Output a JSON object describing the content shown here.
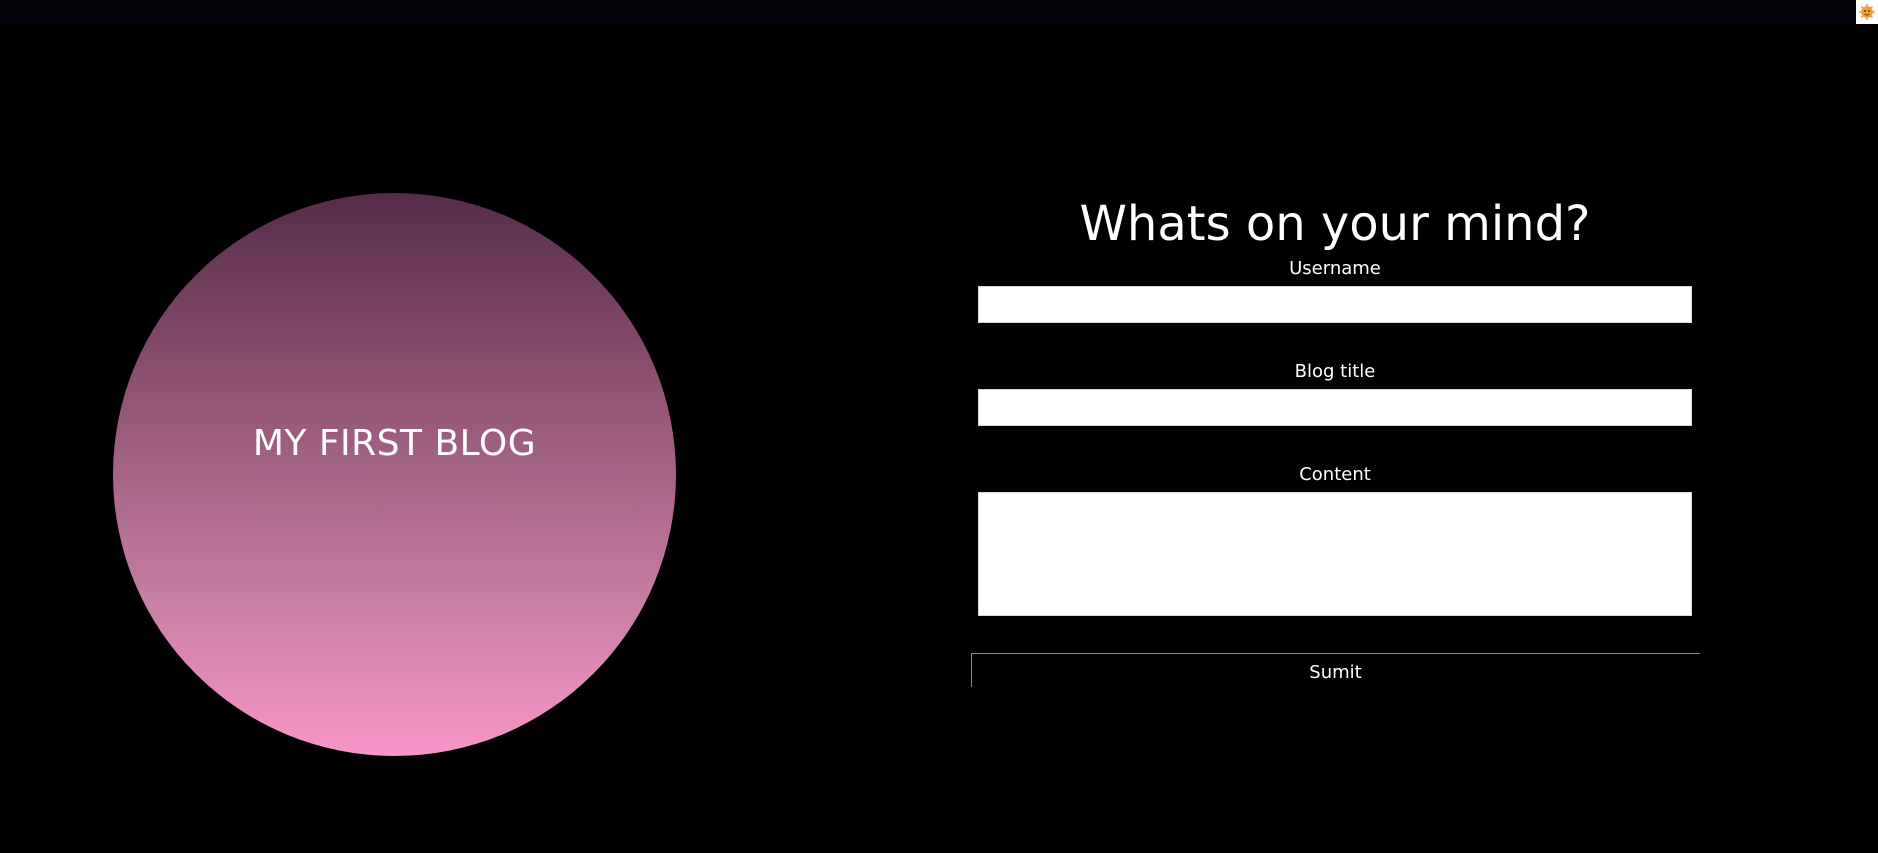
{
  "hero": {
    "title": "MY FIRST BLOG"
  },
  "form": {
    "heading": "Whats on your mind?",
    "username_label": "Username",
    "username_value": "",
    "title_label": "Blog title",
    "title_value": "",
    "content_label": "Content",
    "content_value": "",
    "submit_label": "Sumit"
  },
  "corner": {
    "icon": "extension-icon"
  },
  "colors": {
    "background": "#000000",
    "circle_top": "#562c4a",
    "circle_bottom": "#f896c9",
    "text": "#ffffff"
  }
}
